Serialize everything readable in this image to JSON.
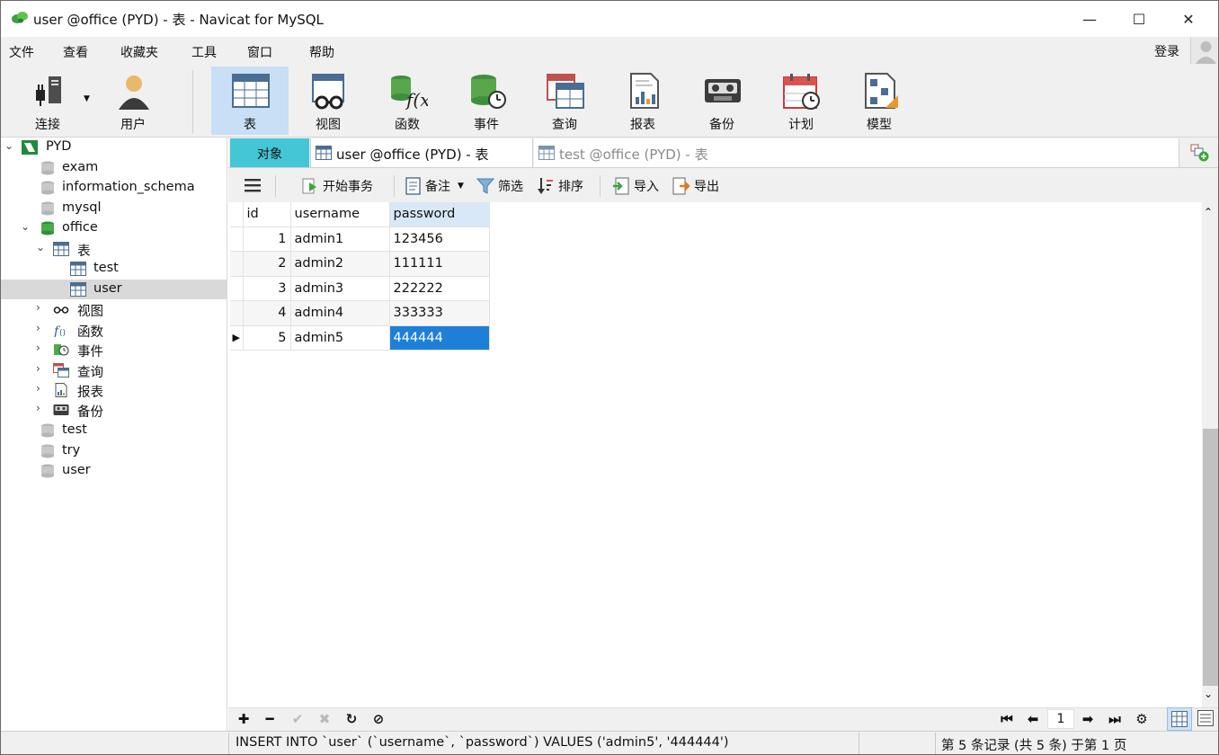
{
  "window": {
    "title": "user @office (PYD) - 表 - Navicat for MySQL",
    "minimize": "—",
    "maximize": "☐",
    "close": "✕"
  },
  "menu": {
    "items": [
      "文件",
      "查看",
      "收藏夹",
      "工具",
      "窗口",
      "帮助"
    ],
    "login": "登录"
  },
  "toolbar": {
    "items": [
      {
        "label": "连接",
        "icon": "connection-icon"
      },
      {
        "label": "用户",
        "icon": "user-icon"
      },
      {
        "label": "表",
        "icon": "table-icon"
      },
      {
        "label": "视图",
        "icon": "view-icon"
      },
      {
        "label": "函数",
        "icon": "function-icon"
      },
      {
        "label": "事件",
        "icon": "event-icon"
      },
      {
        "label": "查询",
        "icon": "query-icon"
      },
      {
        "label": "报表",
        "icon": "report-icon"
      },
      {
        "label": "备份",
        "icon": "backup-icon"
      },
      {
        "label": "计划",
        "icon": "schedule-icon"
      },
      {
        "label": "模型",
        "icon": "model-icon"
      }
    ]
  },
  "sidebar": {
    "connection": "PYD",
    "databases": [
      "exam",
      "information_schema",
      "mysql",
      "office"
    ],
    "office_children": {
      "tables_label": "表",
      "tables": [
        "test",
        "user"
      ],
      "groups": [
        "视图",
        "函数",
        "事件",
        "查询",
        "报表",
        "备份"
      ]
    },
    "more_databases": [
      "test",
      "try",
      "user"
    ]
  },
  "tabs": {
    "objects": "对象",
    "user_tab": "user @office (PYD) - 表",
    "test_tab": "test @office (PYD) - 表"
  },
  "subtoolbar": {
    "begin_tx": "开始事务",
    "note": "备注",
    "filter": "筛选",
    "sort": "排序",
    "import": "导入",
    "export": "导出"
  },
  "grid": {
    "columns": [
      "id",
      "username",
      "password"
    ],
    "rows": [
      {
        "id": "1",
        "username": "admin1",
        "password": "123456"
      },
      {
        "id": "2",
        "username": "admin2",
        "password": "111111"
      },
      {
        "id": "3",
        "username": "admin3",
        "password": "222222"
      },
      {
        "id": "4",
        "username": "admin4",
        "password": "333333"
      },
      {
        "id": "5",
        "username": "admin5",
        "password": "444444"
      }
    ]
  },
  "pagination": {
    "page": "1"
  },
  "status": {
    "sql": "INSERT INTO `user` (`username`, `password`) VALUES ('admin5', '444444')",
    "records": "第 5 条记录 (共 5 条) 于第 1 页"
  },
  "colors": {
    "accent": "#1e7fd8",
    "objects_tab": "#43c6d6",
    "toolbar_active": "#c8dff5"
  }
}
